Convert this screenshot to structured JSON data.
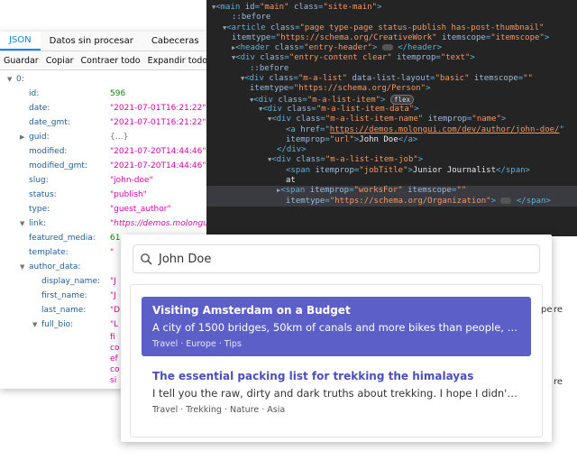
{
  "json_viewer": {
    "tabs": [
      "JSON",
      "Datos sin procesar",
      "Cabeceras"
    ],
    "toolbar": [
      "Guardar",
      "Copiar",
      "Contraer todo",
      "Expandir todo"
    ],
    "rows": [
      {
        "key": "0:",
        "val": "",
        "cls": "",
        "twisty": "open",
        "indent": 0
      },
      {
        "key": "id:",
        "val": "596",
        "cls": "num",
        "indent": 1
      },
      {
        "key": "date:",
        "val": "\"2021-07-01T16:21:22\"",
        "cls": "",
        "indent": 1
      },
      {
        "key": "date_gmt:",
        "val": "\"2021-07-01T16:21:22\"",
        "cls": "",
        "indent": 1
      },
      {
        "key": "guid:",
        "val": "{…}",
        "cls": "obj",
        "twisty": "closed",
        "indent": 1
      },
      {
        "key": "modified:",
        "val": "\"2021-07-20T14:44:46\"",
        "cls": "",
        "indent": 1
      },
      {
        "key": "modified_gmt:",
        "val": "\"2021-07-20T14:44:46\"",
        "cls": "",
        "indent": 1
      },
      {
        "key": "slug:",
        "val": "\"john-doe\"",
        "cls": "",
        "indent": 1
      },
      {
        "key": "status:",
        "val": "\"publish\"",
        "cls": "",
        "indent": 1
      },
      {
        "key": "type:",
        "val": "\"guest_author\"",
        "cls": "",
        "indent": 1
      },
      {
        "key": "link:",
        "val": "\"https://demos.molongui",
        "cls": "ital",
        "twisty": "open",
        "indent": 1
      },
      {
        "key": "featured_media:",
        "val": "61",
        "cls": "num",
        "indent": 1
      },
      {
        "key": "template:",
        "val": "\"",
        "cls": "",
        "indent": 1
      },
      {
        "key": "author_data:",
        "val": "",
        "cls": "",
        "twisty": "open",
        "indent": 1
      },
      {
        "key": "display_name:",
        "val": "\"J",
        "cls": "",
        "indent": 2
      },
      {
        "key": "first_name:",
        "val": "\"J",
        "cls": "",
        "indent": 2
      },
      {
        "key": "last_name:",
        "val": "\"D",
        "cls": "",
        "indent": 2
      },
      {
        "key": "full_bio:",
        "val": "\"L",
        "cls": "",
        "twisty": "open",
        "indent": 2
      }
    ],
    "bio_fragments": [
      "fi",
      "co",
      "ef",
      "co",
      "si"
    ]
  },
  "devtools": {
    "lines": [
      {
        "indent": 0,
        "html": "main"
      },
      {
        "indent": 1,
        "html": "before1"
      },
      {
        "indent": 1,
        "html": "article"
      },
      {
        "indent": 1,
        "html": "article2"
      },
      {
        "indent": 2,
        "html": "header"
      },
      {
        "indent": 2,
        "html": "div_entry"
      },
      {
        "indent": 3,
        "html": "before2"
      },
      {
        "indent": 3,
        "html": "malist"
      },
      {
        "indent": 3,
        "html": "malist2"
      },
      {
        "indent": 4,
        "html": "malistitem"
      },
      {
        "indent": 5,
        "html": "malistitemdata"
      },
      {
        "indent": 6,
        "html": "itemname"
      },
      {
        "indent": 7,
        "html": "ahref"
      },
      {
        "indent": 7,
        "html": "ahref2"
      },
      {
        "indent": 6,
        "html": "divclose"
      },
      {
        "indent": 6,
        "html": "itemjob"
      },
      {
        "indent": 7,
        "html": "spanjob"
      },
      {
        "indent": 7,
        "html": "at"
      },
      {
        "indent": 7,
        "html": "spanworks"
      },
      {
        "indent": 7,
        "html": "spanworks2"
      }
    ],
    "text": {
      "main_id": "\"main\"",
      "main_class": "\"site-main\"",
      "before": "::before",
      "article_class": "\"page type-page status-publish has-post-thumbnail\"",
      "article_itemtype": "\"https://schema.org/CreativeWork\"",
      "article_itemscope": "\"itemscope\"",
      "header_class": "\"entry-header\"",
      "entry_class": "\"entry-content clear\"",
      "entry_itemprop": "\"text\"",
      "malist_class": "\"m-a-list\"",
      "malist_layout": "\"basic\"",
      "malist_itemscope": "\"\"",
      "malist_itemtype": "\"https://schema.org/Person\"",
      "malistitem_class": "\"m-a-list-item\"",
      "flex_badge": "flex",
      "data_class": "\"m-a-list-item-data\"",
      "name_class": "\"m-a-list-item-name\"",
      "name_itemprop": "\"name\"",
      "href": "https://demos.molongui.com/dev/author/john-doe/",
      "a_itemprop": "\"url\"",
      "a_text": "John Doe",
      "job_class": "\"m-a-list-item-job\"",
      "job_itemprop": "\"jobTitle\"",
      "job_text": "Junior Journalist",
      "at": "at",
      "works_itemprop": "\"worksFor\"",
      "works_itemscope": "\"\"",
      "works_itemtype": "\"https://schema.org/Organization\""
    }
  },
  "search": {
    "query": "John Doe",
    "results": [
      {
        "title": "Visiting Amsterdam on a Budget",
        "desc": "A city of 1500 bridges, 50km of canals and more bikes than people, Am...",
        "tags": "Travel · Europe · Tips"
      },
      {
        "title": "The essential packing list for trekking the himalayas",
        "desc": "I tell you the raw, dirty and dark truths about trekking. I hope I didn't st...",
        "tags": "Travel · Trekking · Nature · Asia"
      }
    ],
    "side_fragments": [
      "pe",
      "re",
      "re"
    ]
  }
}
